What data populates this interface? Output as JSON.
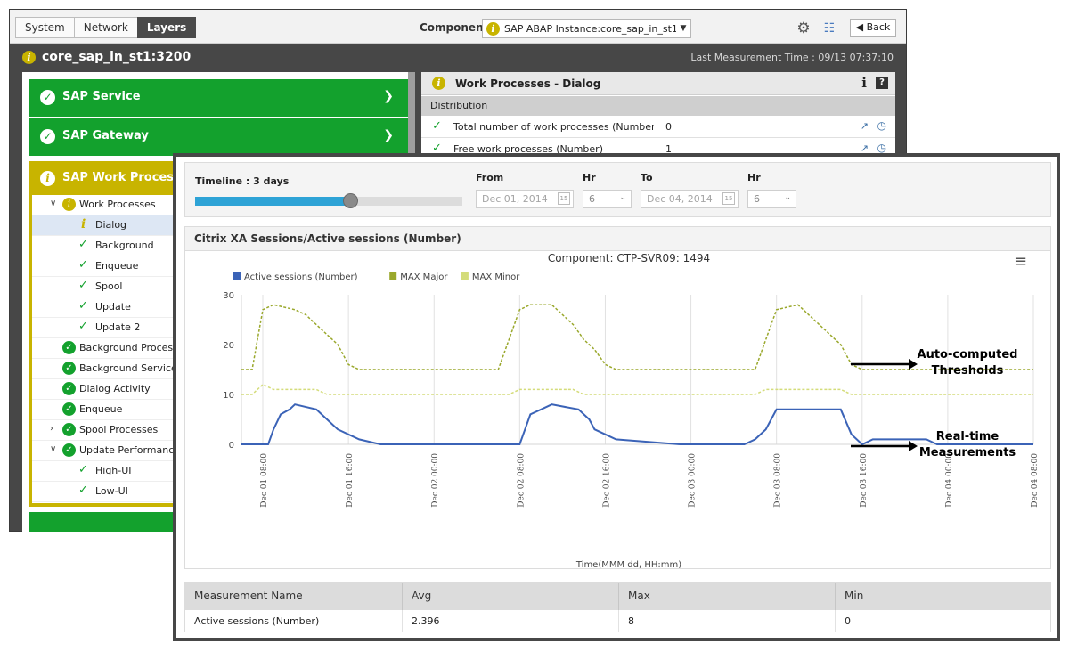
{
  "topbar": {
    "tabs": [
      "System",
      "Network",
      "Layers"
    ],
    "active_tab": "Layers",
    "component_label": "Component",
    "component_value": "SAP ABAP Instance:core_sap_in_st1",
    "back_label": "Back"
  },
  "header": {
    "title": "core_sap_in_st1:3200",
    "last_measurement": "Last Measurement Time : 09/13 07:37:10"
  },
  "layers": {
    "items": [
      {
        "label": "SAP Service",
        "status": "ok"
      },
      {
        "label": "SAP Gateway",
        "status": "ok"
      },
      {
        "label": "SAP Work Processes",
        "status": "warning"
      }
    ],
    "tree": [
      {
        "label": "Work Processes",
        "status": "warning",
        "level": 0,
        "expander": "expanded"
      },
      {
        "label": "Dialog",
        "status": "info",
        "level": 1,
        "selected": true
      },
      {
        "label": "Background",
        "status": "ok",
        "level": 1
      },
      {
        "label": "Enqueue",
        "status": "ok",
        "level": 1
      },
      {
        "label": "Spool",
        "status": "ok",
        "level": 1
      },
      {
        "label": "Update",
        "status": "ok",
        "level": 1
      },
      {
        "label": "Update 2",
        "status": "ok",
        "level": 1
      },
      {
        "label": "Background Processes",
        "status": "ok",
        "level": 0
      },
      {
        "label": "Background Services",
        "status": "ok",
        "level": 0
      },
      {
        "label": "Dialog Activity",
        "status": "ok",
        "level": 0
      },
      {
        "label": "Enqueue",
        "status": "ok",
        "level": 0
      },
      {
        "label": "Spool Processes",
        "status": "ok",
        "level": 0,
        "expander": "collapsed"
      },
      {
        "label": "Update Performance",
        "status": "ok",
        "level": 0,
        "expander": "expanded"
      },
      {
        "label": "High-UI",
        "status": "ok",
        "level": 1
      },
      {
        "label": "Low-UI",
        "status": "ok",
        "level": 1
      }
    ]
  },
  "details": {
    "title": "Work Processes - Dialog",
    "section": "Distribution",
    "rows": [
      {
        "name": "Total number of work processes (Number)",
        "value": "0"
      },
      {
        "name": "Free work processes (Number)",
        "value": "1"
      }
    ]
  },
  "timeline": {
    "label": "Timeline : 3 days",
    "progress": 0.58,
    "from_label": "From",
    "from_date": "Dec 01, 2014",
    "from_hr": "6",
    "to_label": "To",
    "to_date": "Dec 04, 2014",
    "to_hr": "6",
    "hr_label": "Hr"
  },
  "chart_panel": {
    "title": "Citrix XA Sessions/Active sessions (Number)"
  },
  "chart_data": {
    "type": "line",
    "title": "Component: CTP-SVR09: 1494",
    "xlabel": "Time(MMM dd, HH:mm)",
    "ylabel": "",
    "ylim": [
      0,
      30
    ],
    "yticks": [
      0,
      10,
      20,
      30
    ],
    "x_range": [
      "Dec 01 06:00",
      "Dec 04 08:00"
    ],
    "x_tick_labels": [
      "Dec 01 08:00",
      "Dec 01 16:00",
      "Dec 02 00:00",
      "Dec 02 08:00",
      "Dec 02 16:00",
      "Dec 03 00:00",
      "Dec 03 08:00",
      "Dec 03 16:00",
      "Dec 04 00:00",
      "Dec 04 08:00"
    ],
    "legend_position": "top-left",
    "series": [
      {
        "name": "Active sessions (Number)",
        "color": "#3b63b7",
        "style": "solid",
        "points": [
          [
            "Dec 01 06:00",
            0
          ],
          [
            "Dec 01 08:30",
            0
          ],
          [
            "Dec 01 09:00",
            3
          ],
          [
            "Dec 01 09:40",
            6
          ],
          [
            "Dec 01 10:30",
            7
          ],
          [
            "Dec 01 11:00",
            8
          ],
          [
            "Dec 01 13:00",
            7
          ],
          [
            "Dec 01 14:00",
            5
          ],
          [
            "Dec 01 15:00",
            3
          ],
          [
            "Dec 01 16:00",
            2
          ],
          [
            "Dec 01 17:00",
            1
          ],
          [
            "Dec 01 19:00",
            0
          ],
          [
            "Dec 02 00:00",
            0
          ],
          [
            "Dec 02 08:00",
            0
          ],
          [
            "Dec 02 08:30",
            3
          ],
          [
            "Dec 02 09:00",
            6
          ],
          [
            "Dec 02 10:00",
            7
          ],
          [
            "Dec 02 11:00",
            8
          ],
          [
            "Dec 02 13:30",
            7
          ],
          [
            "Dec 02 14:30",
            5
          ],
          [
            "Dec 02 15:00",
            3
          ],
          [
            "Dec 02 16:00",
            2
          ],
          [
            "Dec 02 17:00",
            1
          ],
          [
            "Dec 02 23:00",
            0
          ],
          [
            "Dec 03 05:00",
            0
          ],
          [
            "Dec 03 06:00",
            1
          ],
          [
            "Dec 03 07:00",
            3
          ],
          [
            "Dec 03 08:00",
            7
          ],
          [
            "Dec 03 14:00",
            7
          ],
          [
            "Dec 03 15:00",
            2
          ],
          [
            "Dec 03 16:00",
            0
          ],
          [
            "Dec 03 17:00",
            1
          ],
          [
            "Dec 03 22:00",
            1
          ],
          [
            "Dec 03 23:00",
            0
          ],
          [
            "Dec 04 08:00",
            0
          ]
        ]
      },
      {
        "name": "MAX Major",
        "color": "#9aa82c",
        "style": "dashed",
        "points": [
          [
            "Dec 01 06:00",
            15
          ],
          [
            "Dec 01 07:00",
            15
          ],
          [
            "Dec 01 07:30",
            21
          ],
          [
            "Dec 01 08:00",
            27
          ],
          [
            "Dec 01 09:00",
            28
          ],
          [
            "Dec 01 11:00",
            27
          ],
          [
            "Dec 01 12:00",
            26
          ],
          [
            "Dec 01 13:00",
            24
          ],
          [
            "Dec 01 14:00",
            22
          ],
          [
            "Dec 01 15:00",
            20
          ],
          [
            "Dec 01 16:00",
            16
          ],
          [
            "Dec 01 17:00",
            15
          ],
          [
            "Dec 02 00:00",
            15
          ],
          [
            "Dec 02 06:00",
            15
          ],
          [
            "Dec 02 07:00",
            21
          ],
          [
            "Dec 02 08:00",
            27
          ],
          [
            "Dec 02 09:00",
            28
          ],
          [
            "Dec 02 11:00",
            28
          ],
          [
            "Dec 02 12:00",
            26
          ],
          [
            "Dec 02 13:00",
            24
          ],
          [
            "Dec 02 14:00",
            21
          ],
          [
            "Dec 02 15:00",
            19
          ],
          [
            "Dec 02 16:00",
            16
          ],
          [
            "Dec 02 17:00",
            15
          ],
          [
            "Dec 03 06:00",
            15
          ],
          [
            "Dec 03 07:00",
            21
          ],
          [
            "Dec 03 08:00",
            27
          ],
          [
            "Dec 03 10:00",
            28
          ],
          [
            "Dec 03 11:00",
            26
          ],
          [
            "Dec 03 12:00",
            24
          ],
          [
            "Dec 03 13:00",
            22
          ],
          [
            "Dec 03 14:00",
            20
          ],
          [
            "Dec 03 15:00",
            16
          ],
          [
            "Dec 03 16:00",
            15
          ],
          [
            "Dec 04 08:00",
            15
          ]
        ]
      },
      {
        "name": "MAX Minor",
        "color": "#d4dc7a",
        "style": "dashed",
        "points": [
          [
            "Dec 01 06:00",
            10
          ],
          [
            "Dec 01 07:00",
            10
          ],
          [
            "Dec 01 08:00",
            12
          ],
          [
            "Dec 01 09:00",
            11
          ],
          [
            "Dec 01 13:00",
            11
          ],
          [
            "Dec 01 14:00",
            10
          ],
          [
            "Dec 02 07:00",
            10
          ],
          [
            "Dec 02 08:00",
            11
          ],
          [
            "Dec 02 13:00",
            11
          ],
          [
            "Dec 02 14:00",
            10
          ],
          [
            "Dec 03 06:00",
            10
          ],
          [
            "Dec 03 07:00",
            11
          ],
          [
            "Dec 03 14:00",
            11
          ],
          [
            "Dec 03 15:00",
            10
          ],
          [
            "Dec 04 08:00",
            10
          ]
        ]
      }
    ],
    "annotations": [
      "Auto-computed\nThresholds",
      "Real-time\nMeasurements"
    ]
  },
  "measurements": {
    "headers": [
      "Measurement Name",
      "Avg",
      "Max",
      "Min"
    ],
    "rows": [
      [
        "Active sessions (Number)",
        "2.396",
        "8",
        "0"
      ]
    ]
  }
}
